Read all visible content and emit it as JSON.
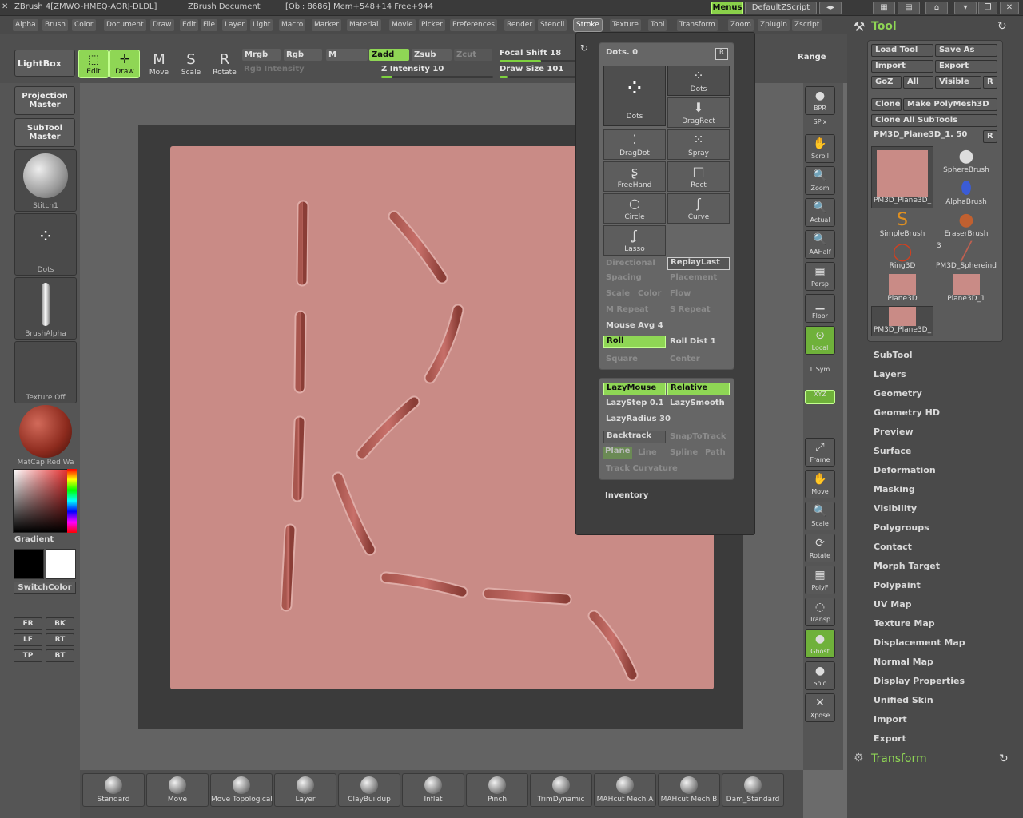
{
  "titlebar": {
    "app": "ZBrush 4[ZMWO-HMEQ-AORJ-DLDL]",
    "doc": "ZBrush Document",
    "stats": "[Obj: 8686] Mem+548+14 Free+944",
    "menus_label": "Menus",
    "script_label": "DefaultZScript"
  },
  "menubar": [
    "Alpha",
    "Brush",
    "Color",
    "Document",
    "Draw",
    "Edit",
    "File",
    "Layer",
    "Light",
    "Macro",
    "Marker",
    "Material",
    "Movie",
    "Picker",
    "Preferences",
    "Render",
    "Stencil",
    "Stroke",
    "Texture",
    "Tool",
    "Transform",
    "Zoom",
    "Zplugin",
    "Zscript"
  ],
  "topshelf": {
    "lightbox": "LightBox",
    "edit": "Edit",
    "draw": "Draw",
    "move": "Move",
    "scale": "Scale",
    "rotate": "Rotate",
    "mrgb": "Mrgb",
    "rgb": "Rgb",
    "m": "M",
    "zadd": "Zadd",
    "zsub": "Zsub",
    "zcut": "Zcut",
    "rgb_intensity": "Rgb Intensity",
    "z_intensity": "Z Intensity 10",
    "z_intensity_level": 0.1,
    "focal_shift": "Focal Shift 18",
    "focal_shift_level": 0.55,
    "draw_size": "Draw Size 101",
    "draw_size_level": 0.1,
    "range": "Range"
  },
  "leftshelf": {
    "projection": "Projection Master",
    "subtool": "SubTool Master",
    "stitch": "Stitch1",
    "dots": "Dots",
    "brushalpha": "BrushAlpha",
    "texture": "Texture Off",
    "matcap": "MatCap Red Wa",
    "gradient": "Gradient",
    "switchcolor": "SwitchColor",
    "views": [
      "FR",
      "BK",
      "LF",
      "RT",
      "TP",
      "BT"
    ]
  },
  "rightshelf": [
    "BPR",
    "SPix",
    "Scroll",
    "Zoom",
    "Actual",
    "AAHalf",
    "Persp",
    "Floor",
    "Local",
    "L.Sym",
    "XYZ",
    "Frame",
    "Move",
    "Scale",
    "Rotate",
    "PolyF",
    "Transp",
    "Ghost",
    "Solo",
    "Xpose"
  ],
  "stroke": {
    "dots_label": "Dots. 0",
    "r": "R",
    "types": [
      "Dots",
      "Dots",
      "DragDot",
      "Spray",
      "FreeHand",
      "Rect",
      "Circle",
      "Curve",
      "Lasso"
    ],
    "drag_rect": "DragRect",
    "directional": "Directional",
    "replay_last": "ReplayLast",
    "spacing": "Spacing",
    "placement": "Placement",
    "scale": "Scale",
    "color": "Color",
    "flow": "Flow",
    "m_repeat": "M Repeat",
    "s_repeat": "S Repeat",
    "mouse_avg": "Mouse Avg 4",
    "roll": "Roll",
    "roll_dist": "Roll Dist 1",
    "square": "Square",
    "center": "Center",
    "lazy_mouse": "LazyMouse",
    "relative": "Relative",
    "lazy_step": "LazyStep 0.1",
    "lazy_smooth": "LazySmooth",
    "lazy_radius": "LazyRadius 30",
    "backtrack": "Backtrack",
    "snap_to_track": "SnapToTrack",
    "plane": "Plane",
    "line": "Line",
    "spline": "Spline",
    "path": "Path",
    "track_curvature": "Track Curvature",
    "inventory": "Inventory"
  },
  "tool": {
    "title": "Tool",
    "load": "Load Tool",
    "save_as": "Save As",
    "import": "Import",
    "export": "Export",
    "goz": "GoZ",
    "all": "All",
    "visible": "Visible",
    "r": "R",
    "clone": "Clone",
    "make_polymesh": "Make PolyMesh3D",
    "clone_all": "Clone All SubTools",
    "current": "PM3D_Plane3D_1. 50",
    "thumbs": [
      "PM3D_Plane3D_",
      "SphereBrush",
      "AlphaBrush",
      "SimpleBrush",
      "EraserBrush",
      "Ring3D",
      "PM3D_Sphereind",
      "Plane3D",
      "Plane3D_1",
      "PM3D_Plane3D_"
    ],
    "thumb_count": "3",
    "sections": [
      "SubTool",
      "Layers",
      "Geometry",
      "Geometry HD",
      "Preview",
      "Surface",
      "Deformation",
      "Masking",
      "Visibility",
      "Polygroups",
      "Contact",
      "Morph Target",
      "Polypaint",
      "UV Map",
      "Texture Map",
      "Displacement Map",
      "Normal Map",
      "Display Properties",
      "Unified Skin",
      "Import",
      "Export"
    ],
    "transform": "Transform"
  },
  "brushes": [
    "Standard",
    "Move",
    "Move Topological",
    "Layer",
    "ClayBuildup",
    "Inflat",
    "Pinch",
    "TrimDynamic",
    "MAHcut Mech A",
    "MAHcut Mech B",
    "Dam_Standard"
  ],
  "colors": {
    "accent": "#8fd655",
    "surface": "#c98b86",
    "bg": "#6b6b6b"
  }
}
